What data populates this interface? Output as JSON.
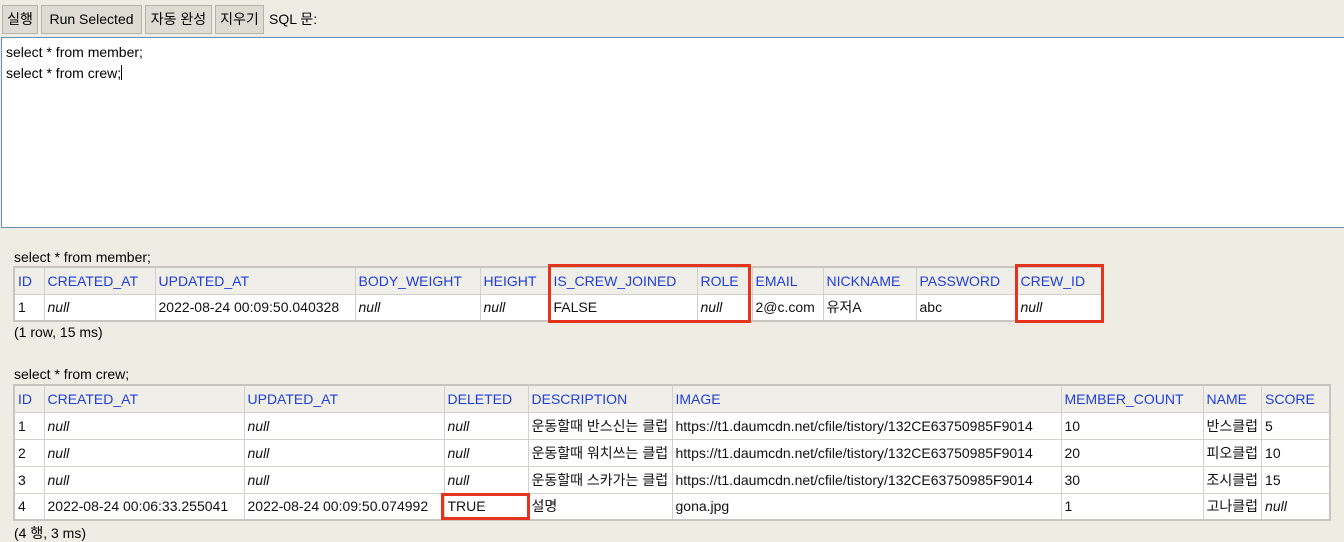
{
  "toolbar": {
    "run_label": "실행",
    "run_selected_label": "Run Selected",
    "autocomplete_label": "자동 완성",
    "clear_label": "지우기",
    "sql_label": "SQL 문:"
  },
  "editor": {
    "lines": [
      "select * from member;",
      "select * from crew;"
    ]
  },
  "results": [
    {
      "query": "select * from member;",
      "columns": [
        "ID",
        "CREATED_AT",
        "UPDATED_AT",
        "BODY_WEIGHT",
        "HEIGHT",
        "IS_CREW_JOINED",
        "ROLE",
        "EMAIL",
        "NICKNAME",
        "PASSWORD",
        "CREW_ID"
      ],
      "rows": [
        [
          "1",
          "null",
          "2022-08-24 00:09:50.040328",
          "null",
          "null",
          "FALSE",
          "null",
          "2@c.com",
          "유저A",
          "abc",
          "null"
        ]
      ],
      "summary": "(1 row, 15 ms)"
    },
    {
      "query": "select * from crew;",
      "columns": [
        "ID",
        "CREATED_AT",
        "UPDATED_AT",
        "DELETED",
        "DESCRIPTION",
        "IMAGE",
        "MEMBER_COUNT",
        "NAME",
        "SCORE"
      ],
      "rows": [
        [
          "1",
          "null",
          "null",
          "null",
          "운동할때 반스신는 클럽",
          "https://t1.daumcdn.net/cfile/tistory/132CE63750985F9014",
          "10",
          "반스클럽",
          "5"
        ],
        [
          "2",
          "null",
          "null",
          "null",
          "운동할때 워치쓰는 클럽",
          "https://t1.daumcdn.net/cfile/tistory/132CE63750985F9014",
          "20",
          "피오클럽",
          "10"
        ],
        [
          "3",
          "null",
          "null",
          "null",
          "운동할때 스카가는 클럽",
          "https://t1.daumcdn.net/cfile/tistory/132CE63750985F9014",
          "30",
          "조시클럽",
          "15"
        ],
        [
          "4",
          "2022-08-24 00:06:33.255041",
          "2022-08-24 00:09:50.074992",
          "TRUE",
          "설명",
          "gona.jpg",
          "1",
          "고나클럽",
          "null"
        ]
      ],
      "summary": "(4 행, 3 ms)"
    }
  ],
  "colors": {
    "header_text": "#1f3edb",
    "highlight": "#e5341d",
    "editor_border": "#6d8fb3"
  }
}
